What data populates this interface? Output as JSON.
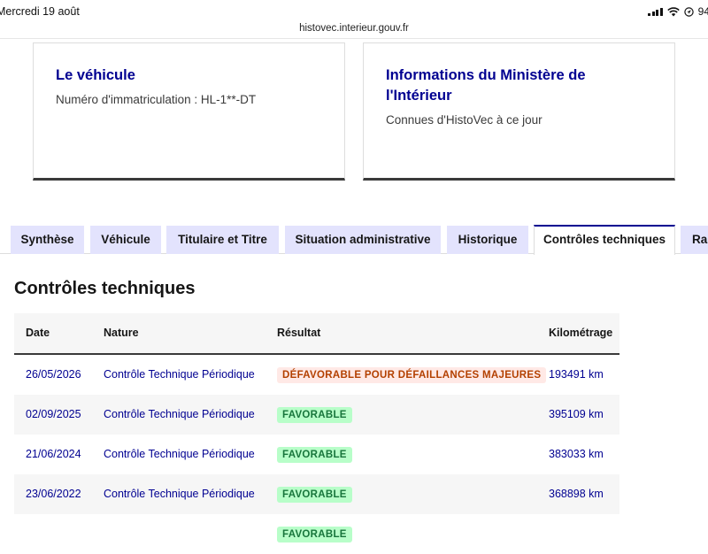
{
  "status_bar": {
    "time": "Mercredi 19 août",
    "battery": "94"
  },
  "browser": {
    "url": "histovec.interieur.gouv.fr"
  },
  "cards": {
    "vehicule": {
      "title": "Le véhicule",
      "text": "Numéro d'immatriculation : HL-1**-DT"
    },
    "ministere": {
      "title": "Informations du Ministère de l'Intérieur",
      "text": "Connues d'HistoVec à ce jour"
    }
  },
  "tabs": [
    {
      "label": "Synthèse",
      "active": false
    },
    {
      "label": "Véhicule",
      "active": false
    },
    {
      "label": "Titulaire et Titre",
      "active": false
    },
    {
      "label": "Situation administrative",
      "active": false
    },
    {
      "label": "Historique",
      "active": false
    },
    {
      "label": "Contrôles techniques",
      "active": true
    },
    {
      "label": "Rap",
      "active": false
    }
  ],
  "section": {
    "title": "Contrôles techniques"
  },
  "table": {
    "headers": {
      "date": "Date",
      "nature": "Nature",
      "resultat": "Résultat",
      "km": "Kilométrage"
    },
    "rows": [
      {
        "date": "26/05/2026",
        "nature": "Contrôle Technique Périodique",
        "resultat": "DÉFAVORABLE POUR DÉFAILLANCES MAJEURES",
        "status": "bad",
        "km": "193491 km"
      },
      {
        "date": "02/09/2025",
        "nature": "Contrôle Technique Périodique",
        "resultat": "FAVORABLE",
        "status": "good",
        "km": "395109 km"
      },
      {
        "date": "21/06/2024",
        "nature": "Contrôle Technique Périodique",
        "resultat": "FAVORABLE",
        "status": "good",
        "km": "383033 km"
      },
      {
        "date": "23/06/2022",
        "nature": "Contrôle Technique Périodique",
        "resultat": "FAVORABLE",
        "status": "good",
        "km": "368898 km"
      },
      {
        "date": "",
        "nature": "",
        "resultat": "FAVORABLE",
        "status": "good",
        "km": ""
      }
    ]
  },
  "colors": {
    "brand_blue": "#000091",
    "tab_bg": "#e3e3fd",
    "error_bg": "#ffe9e6",
    "error_text": "#b34000",
    "success_bg": "#b8fec9",
    "success_text": "#18753c"
  },
  "icons": {
    "signal": "cellular-signal-icon",
    "wifi": "wifi-icon",
    "location": "location-icon"
  }
}
